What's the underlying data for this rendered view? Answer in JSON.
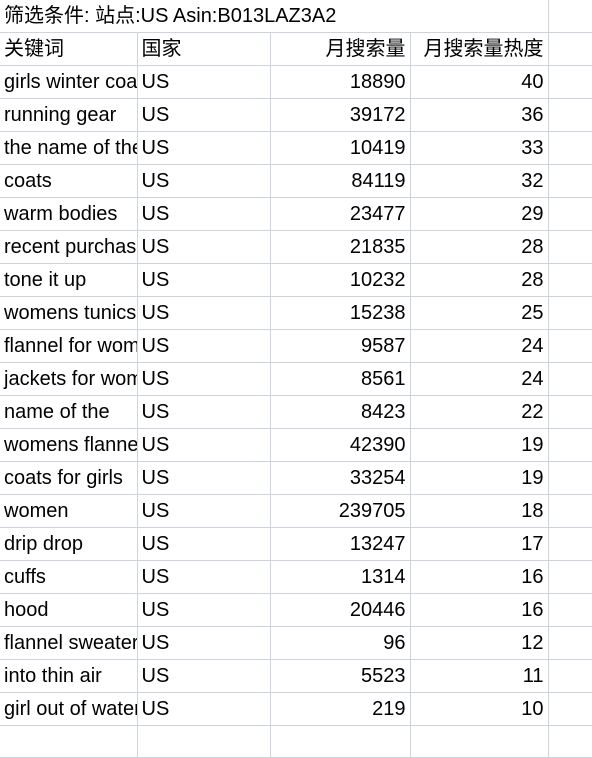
{
  "document": {
    "type": "spreadsheet",
    "filter_title": "筛选条件: 站点:US Asin:B013LAZ3A2"
  },
  "table": {
    "columns": [
      {
        "key": "keyword",
        "label": "关键词",
        "align": "left"
      },
      {
        "key": "country",
        "label": "国家",
        "align": "left"
      },
      {
        "key": "volume",
        "label": "月搜索量",
        "align": "right"
      },
      {
        "key": "heat",
        "label": "月搜索量热度",
        "align": "right"
      },
      {
        "key": "blank",
        "label": "",
        "align": "left"
      }
    ],
    "rows": [
      {
        "keyword": "girls winter coats",
        "country": "US",
        "volume": "18890",
        "heat": "40"
      },
      {
        "keyword": "running gear",
        "country": "US",
        "volume": "39172",
        "heat": "36"
      },
      {
        "keyword": "the name of the",
        "country": "US",
        "volume": "10419",
        "heat": "33"
      },
      {
        "keyword": "coats",
        "country": "US",
        "volume": "84119",
        "heat": "32"
      },
      {
        "keyword": "warm bodies",
        "country": "US",
        "volume": "23477",
        "heat": "29"
      },
      {
        "keyword": "recent purchases",
        "country": "US",
        "volume": "21835",
        "heat": "28"
      },
      {
        "keyword": "tone it up",
        "country": "US",
        "volume": "10232",
        "heat": "28"
      },
      {
        "keyword": "womens tunics",
        "country": "US",
        "volume": "15238",
        "heat": "25"
      },
      {
        "keyword": "flannel for women",
        "country": "US",
        "volume": "9587",
        "heat": "24"
      },
      {
        "keyword": "jackets for women",
        "country": "US",
        "volume": "8561",
        "heat": "24"
      },
      {
        "keyword": "name of the",
        "country": "US",
        "volume": "8423",
        "heat": "22"
      },
      {
        "keyword": "womens flannel",
        "country": "US",
        "volume": "42390",
        "heat": "19"
      },
      {
        "keyword": "coats for girls",
        "country": "US",
        "volume": "33254",
        "heat": "19"
      },
      {
        "keyword": "women",
        "country": "US",
        "volume": "239705",
        "heat": "18"
      },
      {
        "keyword": "drip drop",
        "country": "US",
        "volume": "13247",
        "heat": "17"
      },
      {
        "keyword": "cuffs",
        "country": "US",
        "volume": "1314",
        "heat": "16"
      },
      {
        "keyword": "hood",
        "country": "US",
        "volume": "20446",
        "heat": "16"
      },
      {
        "keyword": "flannel sweater",
        "country": "US",
        "volume": "96",
        "heat": "12"
      },
      {
        "keyword": "into thin air",
        "country": "US",
        "volume": "5523",
        "heat": "11"
      },
      {
        "keyword": "girl out of water",
        "country": "US",
        "volume": "219",
        "heat": "10"
      }
    ],
    "trailing_empty_rows": 1
  },
  "colors": {
    "gridline": "#ccd4e0",
    "header_border": "#9aa3ae",
    "text": "#000000",
    "background": "#ffffff"
  }
}
